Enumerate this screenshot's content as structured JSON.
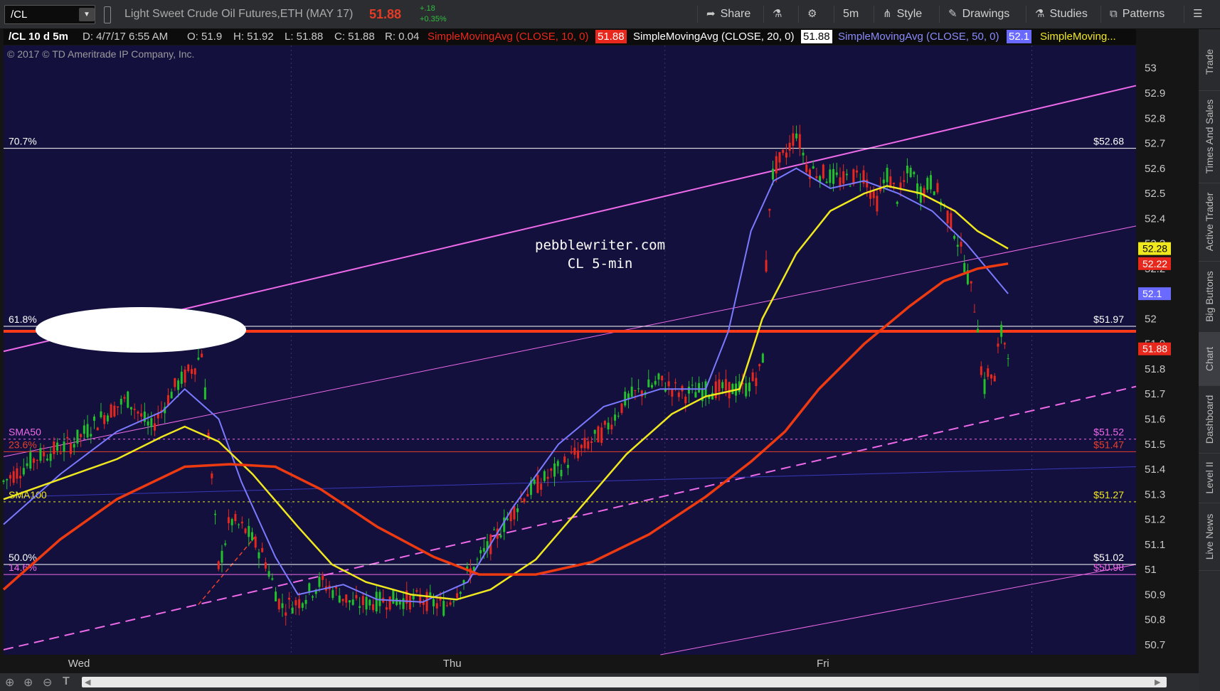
{
  "toolbar": {
    "symbol": "/CL",
    "instrument": "Light Sweet Crude Oil Futures,ETH (MAY 17)",
    "last": "51.88",
    "change": "+.18",
    "change_pct": "+0.35%",
    "share": "Share",
    "timeframe": "5m",
    "style": "Style",
    "drawings": "Drawings",
    "studies": "Studies",
    "patterns": "Patterns",
    "icons": [
      "share-icon",
      "flask-icon",
      "gear-icon",
      "style-icon",
      "pencil-icon",
      "studies-icon",
      "patterns-icon",
      "menu-icon"
    ]
  },
  "infobar": {
    "header": "/CL 10 d 5m",
    "date": "D: 4/7/17 6:55 AM",
    "open": "O: 51.9",
    "high": "H: 51.92",
    "low": "L: 51.88",
    "close": "C: 51.88",
    "range": "R: 0.04",
    "sma10_label": "SimpleMovingAvg (CLOSE, 10, 0)",
    "sma10_value": "51.88",
    "sma20_label": "SimpleMovingAvg (CLOSE, 20, 0)",
    "sma20_value": "51.88",
    "sma50_label": "SimpleMovingAvg (CLOSE, 50, 0)",
    "sma50_value": "52.1",
    "sma_more": "SimpleMoving..."
  },
  "copyright": "2017 © TD Ameritrade IP Company, Inc.",
  "watermark": [
    "pebblewriter.com",
    "CL 5-min"
  ],
  "sidebar": [
    "Trade",
    "Times And Sales",
    "Active Trader",
    "Big Buttons",
    "Chart",
    "Dashboard",
    "Level II",
    "Live News"
  ],
  "colors": {
    "background": "#13103e",
    "candle_up": "#22c02a",
    "candle_down": "#e8281c",
    "sma10": "#e8281c",
    "sma20": "#ffffff",
    "sma50": "#7a7aff",
    "sma100": "#f0e81e",
    "sma200": "#ee3a10",
    "channel": "#ef6ae8",
    "fib": "#ffffff",
    "key_level": "#ff3a18"
  },
  "chart_data": {
    "type": "candlestick",
    "y_ticks": [
      53,
      52.9,
      52.8,
      52.7,
      52.6,
      52.5,
      52.4,
      52.3,
      52.2,
      52.1,
      52,
      51.9,
      51.8,
      51.7,
      51.6,
      51.5,
      51.4,
      51.3,
      51.2,
      51.1,
      51,
      50.9,
      50.8,
      50.7
    ],
    "ylim": [
      50.66,
      53.09
    ],
    "x_labels": [
      "Wed",
      "Thu",
      "Fri"
    ],
    "hlines": [
      {
        "label": "70.7%",
        "value": 52.68,
        "value_label": "$52.68",
        "color": "#ffffff",
        "style": "solid"
      },
      {
        "label": "61.8%",
        "value": 51.97,
        "value_label": "$51.97",
        "color": "#ffffff",
        "style": "solid"
      },
      {
        "label": "SMA50",
        "value": 51.52,
        "value_label": "$51.52",
        "color": "#ef6ae8",
        "style": "dotted"
      },
      {
        "label": "23.6%",
        "value": 51.47,
        "value_label": "$51.47",
        "color": "#e8402a",
        "style": "solid"
      },
      {
        "label": "SMA100",
        "value": 51.27,
        "value_label": "$51.27",
        "color": "#f0e81e",
        "style": "dotted"
      },
      {
        "label": "50.0%",
        "value": 51.02,
        "value_label": "$51.02",
        "color": "#ffffff",
        "style": "solid"
      },
      {
        "label": "14.6%",
        "value": 50.98,
        "value_label": "$50.98",
        "color": "#ef6ae8",
        "style": "solid"
      }
    ],
    "key_level": 51.95,
    "price_tags": [
      {
        "value": 52.28,
        "label": "52.28",
        "color": "#f0e81e",
        "text": "#000000"
      },
      {
        "value": 52.22,
        "label": "52.22",
        "color": "#e8281c",
        "text": "#ffffff"
      },
      {
        "value": 52.1,
        "label": "52.1",
        "color": "#6a6aff",
        "text": "#ffffff"
      },
      {
        "value": 51.88,
        "label": "51.88",
        "color": "#e8281c",
        "text": "#ffffff"
      }
    ],
    "sma200": [
      [
        0,
        50.92
      ],
      [
        0.05,
        51.12
      ],
      [
        0.1,
        51.28
      ],
      [
        0.16,
        51.41
      ],
      [
        0.2,
        51.42
      ],
      [
        0.24,
        51.41
      ],
      [
        0.28,
        51.32
      ],
      [
        0.33,
        51.17
      ],
      [
        0.38,
        51.05
      ],
      [
        0.42,
        50.98
      ],
      [
        0.47,
        50.98
      ],
      [
        0.52,
        51.03
      ],
      [
        0.57,
        51.14
      ],
      [
        0.62,
        51.29
      ],
      [
        0.66,
        51.43
      ],
      [
        0.69,
        51.55
      ],
      [
        0.72,
        51.72
      ],
      [
        0.76,
        51.9
      ],
      [
        0.8,
        52.05
      ],
      [
        0.83,
        52.15
      ],
      [
        0.86,
        52.2
      ],
      [
        0.887,
        52.22
      ]
    ],
    "sma100": [
      [
        0,
        51.28
      ],
      [
        0.05,
        51.36
      ],
      [
        0.1,
        51.44
      ],
      [
        0.14,
        51.53
      ],
      [
        0.16,
        51.57
      ],
      [
        0.19,
        51.51
      ],
      [
        0.22,
        51.38
      ],
      [
        0.26,
        51.17
      ],
      [
        0.29,
        51.02
      ],
      [
        0.32,
        50.95
      ],
      [
        0.36,
        50.9
      ],
      [
        0.4,
        50.88
      ],
      [
        0.43,
        50.92
      ],
      [
        0.47,
        51.04
      ],
      [
        0.51,
        51.25
      ],
      [
        0.55,
        51.46
      ],
      [
        0.59,
        51.62
      ],
      [
        0.62,
        51.69
      ],
      [
        0.65,
        51.72
      ],
      [
        0.67,
        52.0
      ],
      [
        0.7,
        52.26
      ],
      [
        0.73,
        52.43
      ],
      [
        0.76,
        52.5
      ],
      [
        0.78,
        52.53
      ],
      [
        0.81,
        52.5
      ],
      [
        0.84,
        52.43
      ],
      [
        0.86,
        52.35
      ],
      [
        0.887,
        52.28
      ]
    ],
    "sma50": [
      [
        0,
        51.18
      ],
      [
        0.05,
        51.38
      ],
      [
        0.1,
        51.55
      ],
      [
        0.14,
        51.63
      ],
      [
        0.16,
        51.72
      ],
      [
        0.19,
        51.6
      ],
      [
        0.21,
        51.35
      ],
      [
        0.24,
        51.05
      ],
      [
        0.26,
        50.9
      ],
      [
        0.3,
        50.94
      ],
      [
        0.33,
        50.88
      ],
      [
        0.37,
        50.87
      ],
      [
        0.41,
        50.95
      ],
      [
        0.45,
        51.25
      ],
      [
        0.49,
        51.5
      ],
      [
        0.53,
        51.65
      ],
      [
        0.58,
        51.72
      ],
      [
        0.62,
        51.72
      ],
      [
        0.64,
        51.95
      ],
      [
        0.66,
        52.35
      ],
      [
        0.68,
        52.55
      ],
      [
        0.7,
        52.6
      ],
      [
        0.73,
        52.52
      ],
      [
        0.76,
        52.55
      ],
      [
        0.79,
        52.5
      ],
      [
        0.82,
        52.43
      ],
      [
        0.85,
        52.3
      ],
      [
        0.887,
        52.1
      ]
    ]
  }
}
